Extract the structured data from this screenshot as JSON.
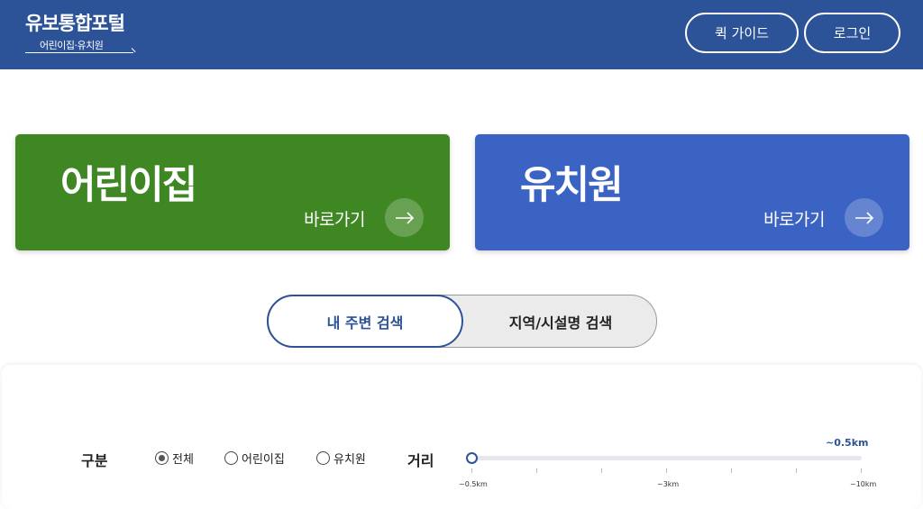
{
  "header": {
    "logo_title": "유보통합포털",
    "logo_subtitle": "어린이집·유치원",
    "guide_button": "퀵 가이드",
    "login_button": "로그인",
    "bg_color": "#2c5298"
  },
  "cards": {
    "daycare": {
      "title": "어린이집",
      "link": "바로가기",
      "color": "#3f8723"
    },
    "kindergarten": {
      "title": "유치원",
      "link": "바로가기",
      "color": "#3b63c4"
    }
  },
  "search_tabs": {
    "nearby": "내 주변 검색",
    "region": "지역/시설명 검색",
    "active": "nearby"
  },
  "filters": {
    "category_label": "구분",
    "options": [
      "전체",
      "어린이집",
      "유치원"
    ],
    "selected": "전체",
    "distance_label": "거리",
    "distance_value": "~0.5km",
    "distance_ticks": [
      "~0.5km",
      "~3km",
      "~10km"
    ]
  }
}
